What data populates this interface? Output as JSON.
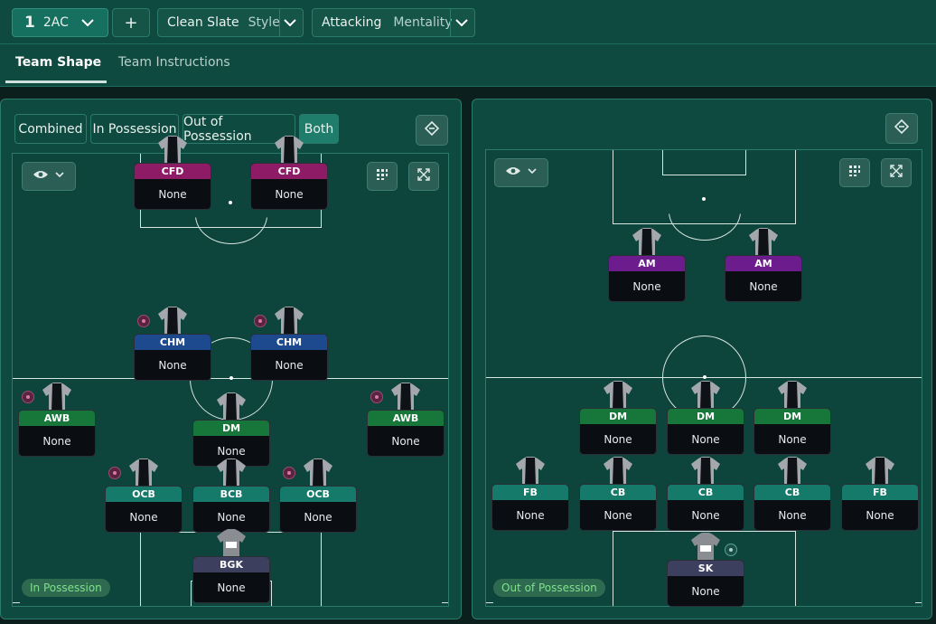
{
  "colors": {
    "forward": "#8e1b65",
    "midfield_blue": "#1d4a8f",
    "green": "#17763a",
    "teal": "#167a6a",
    "keeper": "#3c3f5e",
    "attacking_mid": "#6c1c8c"
  },
  "topbar": {
    "formation_number": "1",
    "formation_name": "2AC",
    "add_label": "+",
    "style": {
      "value": "Clean Slate",
      "label": "Style"
    },
    "mentality": {
      "value": "Attacking",
      "label": "Mentality"
    }
  },
  "tabs": [
    {
      "label": "Team Shape",
      "active": true
    },
    {
      "label": "Team Instructions",
      "active": false
    }
  ],
  "left_panel": {
    "filters": [
      {
        "label": "Combined"
      },
      {
        "label": "In Possession"
      },
      {
        "label": "Out of Possession"
      },
      {
        "label": "Both",
        "selected": true
      }
    ],
    "phase_label": "In Possession",
    "players": [
      {
        "role": "CFD",
        "name": "None",
        "color": "forward",
        "badge": false
      },
      {
        "role": "CFD",
        "name": "None",
        "color": "forward",
        "badge": false
      },
      {
        "role": "CHM",
        "name": "None",
        "color": "midfield_blue",
        "badge": true
      },
      {
        "role": "CHM",
        "name": "None",
        "color": "midfield_blue",
        "badge": true
      },
      {
        "role": "AWB",
        "name": "None",
        "color": "green",
        "badge": true
      },
      {
        "role": "DM",
        "name": "None",
        "color": "green",
        "badge": false
      },
      {
        "role": "AWB",
        "name": "None",
        "color": "green",
        "badge": true
      },
      {
        "role": "OCB",
        "name": "None",
        "color": "teal",
        "badge": true
      },
      {
        "role": "BCB",
        "name": "None",
        "color": "teal",
        "badge": false
      },
      {
        "role": "OCB",
        "name": "None",
        "color": "teal",
        "badge": true
      },
      {
        "role": "BGK",
        "name": "None",
        "color": "keeper",
        "badge": false
      }
    ]
  },
  "right_panel": {
    "phase_label": "Out of Possession",
    "players": [
      {
        "role": "AM",
        "name": "None",
        "color": "attacking_mid",
        "badge": false
      },
      {
        "role": "AM",
        "name": "None",
        "color": "attacking_mid",
        "badge": false
      },
      {
        "role": "DM",
        "name": "None",
        "color": "green",
        "badge": false
      },
      {
        "role": "DM",
        "name": "None",
        "color": "green",
        "badge": false
      },
      {
        "role": "DM",
        "name": "None",
        "color": "green",
        "badge": false
      },
      {
        "role": "FB",
        "name": "None",
        "color": "teal",
        "badge": false
      },
      {
        "role": "CB",
        "name": "None",
        "color": "teal",
        "badge": false
      },
      {
        "role": "CB",
        "name": "None",
        "color": "teal",
        "badge": false
      },
      {
        "role": "CB",
        "name": "None",
        "color": "teal",
        "badge": false
      },
      {
        "role": "FB",
        "name": "None",
        "color": "teal",
        "badge": false
      },
      {
        "role": "SK",
        "name": "None",
        "color": "keeper",
        "badge": true
      }
    ]
  }
}
